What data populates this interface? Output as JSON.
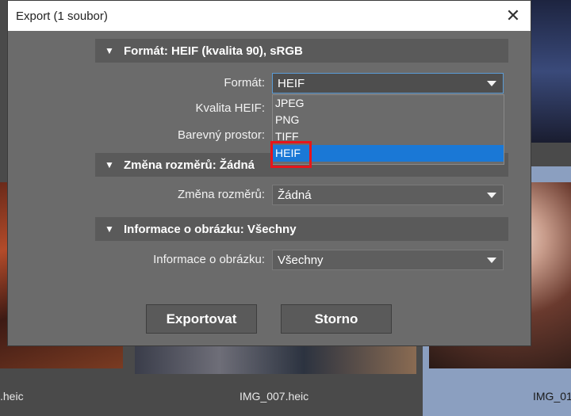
{
  "dialog": {
    "title": "Export (1 soubor)",
    "close_symbol": "✕"
  },
  "sections": {
    "format": {
      "header": "Formát: HEIF (kvalita 90), sRGB",
      "format_label": "Formát:",
      "format_value": "HEIF",
      "quality_label": "Kvalita HEIF:",
      "colorspace_label": "Barevný prostor:",
      "options": [
        "JPEG",
        "PNG",
        "TIFF",
        "HEIF"
      ],
      "selected_option": "HEIF"
    },
    "resize": {
      "header": "Změna rozměrů: Žádná",
      "label": "Změna rozměrů:",
      "value": "Žádná"
    },
    "info": {
      "header": "Informace o obrázku: Všechny",
      "label": "Informace o obrázku:",
      "value": "Všechny"
    }
  },
  "buttons": {
    "export": "Exportovat",
    "cancel": "Storno"
  },
  "gallery": {
    "captions": [
      ".heic",
      "IMG_007.heic",
      "IMG_01"
    ]
  },
  "colors": {
    "dialog_bg": "#6b6b6b",
    "section_bg": "#5a5a5a",
    "selection_blue": "#1a78d6",
    "highlight_red": "#e8141a"
  }
}
